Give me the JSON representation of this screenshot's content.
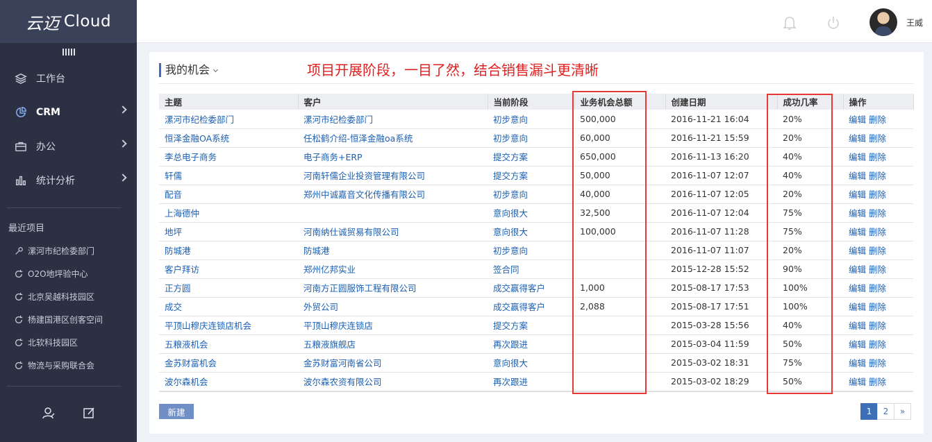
{
  "brand": {
    "logo_mark": "云迈",
    "logo_text": "Cloud"
  },
  "sidebar": {
    "nav": [
      {
        "label": "工作台",
        "icon": "layers-icon",
        "active": false,
        "has_children": false
      },
      {
        "label": "CRM",
        "icon": "pie-chart-icon",
        "active": true,
        "has_children": true
      },
      {
        "label": "办公",
        "icon": "briefcase-icon",
        "active": false,
        "has_children": true
      },
      {
        "label": "统计分析",
        "icon": "bar-chart-icon",
        "active": false,
        "has_children": true
      }
    ],
    "recent_title": "最近项目",
    "recent": [
      {
        "label": "漯河市纪检委部门",
        "icon": "wrench-icon"
      },
      {
        "label": "O2O地坪验中心",
        "icon": "refresh-icon"
      },
      {
        "label": "北京吴越科技园区",
        "icon": "refresh-icon"
      },
      {
        "label": "杨建国港区创客空间",
        "icon": "refresh-icon"
      },
      {
        "label": "北软科技园区",
        "icon": "refresh-icon"
      },
      {
        "label": "物流与采购联合会",
        "icon": "refresh-icon"
      }
    ]
  },
  "topbar": {
    "username": "王威"
  },
  "panel": {
    "title": "我的机会",
    "annotation": "项目开展阶段，一目了然，结合销售漏斗更清晰"
  },
  "table": {
    "headers": [
      "主题",
      "客户",
      "当前阶段",
      "业务机会总额",
      "创建日期",
      "成功几率",
      "操作"
    ],
    "edit_label": "编辑",
    "delete_label": "删除",
    "rows": [
      {
        "subject": "漯河市纪检委部门",
        "customer": "漯河市纪检委部门",
        "stage": "初步意向",
        "amount": "500,000",
        "date": "2016-11-21 16:04",
        "rate": "20%"
      },
      {
        "subject": "恒泽金融OA系统",
        "customer": "任松鹤介绍-恒泽金融oa系统",
        "stage": "初步意向",
        "amount": "60,000",
        "date": "2016-11-21 15:59",
        "rate": "20%"
      },
      {
        "subject": "李总电子商务",
        "customer": "电子商务+ERP",
        "stage": "提交方案",
        "amount": "650,000",
        "date": "2016-11-13 16:20",
        "rate": "40%"
      },
      {
        "subject": "轩儒",
        "customer": "河南轩儒企业投资管理有限公司",
        "stage": "提交方案",
        "amount": "50,000",
        "date": "2016-11-07 12:07",
        "rate": "40%"
      },
      {
        "subject": "配音",
        "customer": "郑州中诚嘉音文化传播有限公司",
        "stage": "初步意向",
        "amount": "40,000",
        "date": "2016-11-07 12:05",
        "rate": "20%"
      },
      {
        "subject": "上海德仲",
        "customer": "",
        "stage": "意向很大",
        "amount": "32,500",
        "date": "2016-11-07 12:04",
        "rate": "75%"
      },
      {
        "subject": "地坪",
        "customer": "河南纳仕诚贸易有限公司",
        "stage": "意向很大",
        "amount": "100,000",
        "date": "2016-11-07 11:28",
        "rate": "75%"
      },
      {
        "subject": "防城港",
        "customer": "防城港",
        "stage": "初步意向",
        "amount": "",
        "date": "2016-11-07 11:07",
        "rate": "20%"
      },
      {
        "subject": "客户拜访",
        "customer": "郑州亿邦实业",
        "stage": "签合同",
        "amount": "",
        "date": "2015-12-28 15:52",
        "rate": "90%"
      },
      {
        "subject": "正方圆",
        "customer": "河南方正圆服饰工程有限公司",
        "stage": "成交赢得客户",
        "amount": "1,000",
        "date": "2015-08-17 17:53",
        "rate": "100%"
      },
      {
        "subject": "成交",
        "customer": "外贸公司",
        "stage": "成交赢得客户",
        "amount": "2,088",
        "date": "2015-08-17 17:51",
        "rate": "100%"
      },
      {
        "subject": "平顶山穆庆连锁店机会",
        "customer": "平顶山穆庆连锁店",
        "stage": "提交方案",
        "amount": "",
        "date": "2015-03-28 15:56",
        "rate": "40%"
      },
      {
        "subject": "五粮液机会",
        "customer": "五粮液旗舰店",
        "stage": "再次跟进",
        "amount": "",
        "date": "2015-03-04 11:59",
        "rate": "50%"
      },
      {
        "subject": "金苏财富机会",
        "customer": "金苏财富河南省公司",
        "stage": "意向很大",
        "amount": "",
        "date": "2015-03-02 18:31",
        "rate": "75%"
      },
      {
        "subject": "波尔森机会",
        "customer": "波尔森农资有限公司",
        "stage": "再次跟进",
        "amount": "",
        "date": "2015-03-02 18:29",
        "rate": "50%"
      }
    ]
  },
  "footer": {
    "new_button": "新建",
    "pages": [
      "1",
      "2"
    ],
    "next": "»",
    "current_page": "1"
  },
  "colors": {
    "sidebar_bg": "#2b3043",
    "logo_bg": "#3a4259",
    "accent": "#3c6fb5",
    "link": "#1a5fb4",
    "highlight": "#e53935"
  }
}
